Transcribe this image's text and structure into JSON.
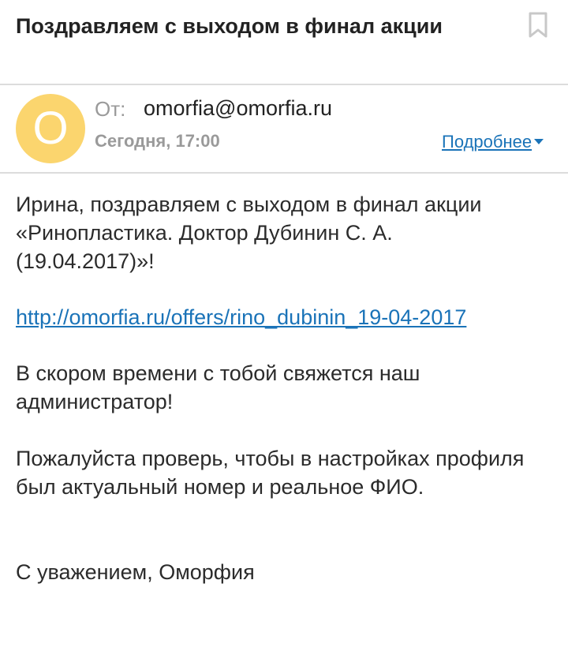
{
  "email": {
    "subject": "Поздравляем с выходом в финал акции",
    "sender": {
      "avatar_letter": "O",
      "from_label": "От:",
      "address": "omorfia@omorfia.ru",
      "date": "Сегодня, 17:00"
    },
    "details_label": "Подробнее",
    "body": {
      "paragraph_1": "Ирина, поздравляем с выходом в финал акции «Ринопластика. Доктор Дубинин С. А. (19.04.2017)»!",
      "link": "http://omorfia.ru/offers/rino_dubinin_19-04-2017",
      "paragraph_2": "В скором времени с тобой свяжется наш администратор!",
      "paragraph_3": "Пожалуйста проверь, чтобы в настройках профиля был актуальный номер и реальное ФИО.",
      "signature": "С уважением, Оморфия"
    }
  },
  "icons": {
    "bookmark": "bookmark-icon",
    "details_caret": "caret-down-icon"
  },
  "colors": {
    "avatar_bg": "#fbd56e",
    "link": "#1a73b8",
    "muted_text": "#9a9a9a",
    "divider": "#dcdcdc"
  }
}
